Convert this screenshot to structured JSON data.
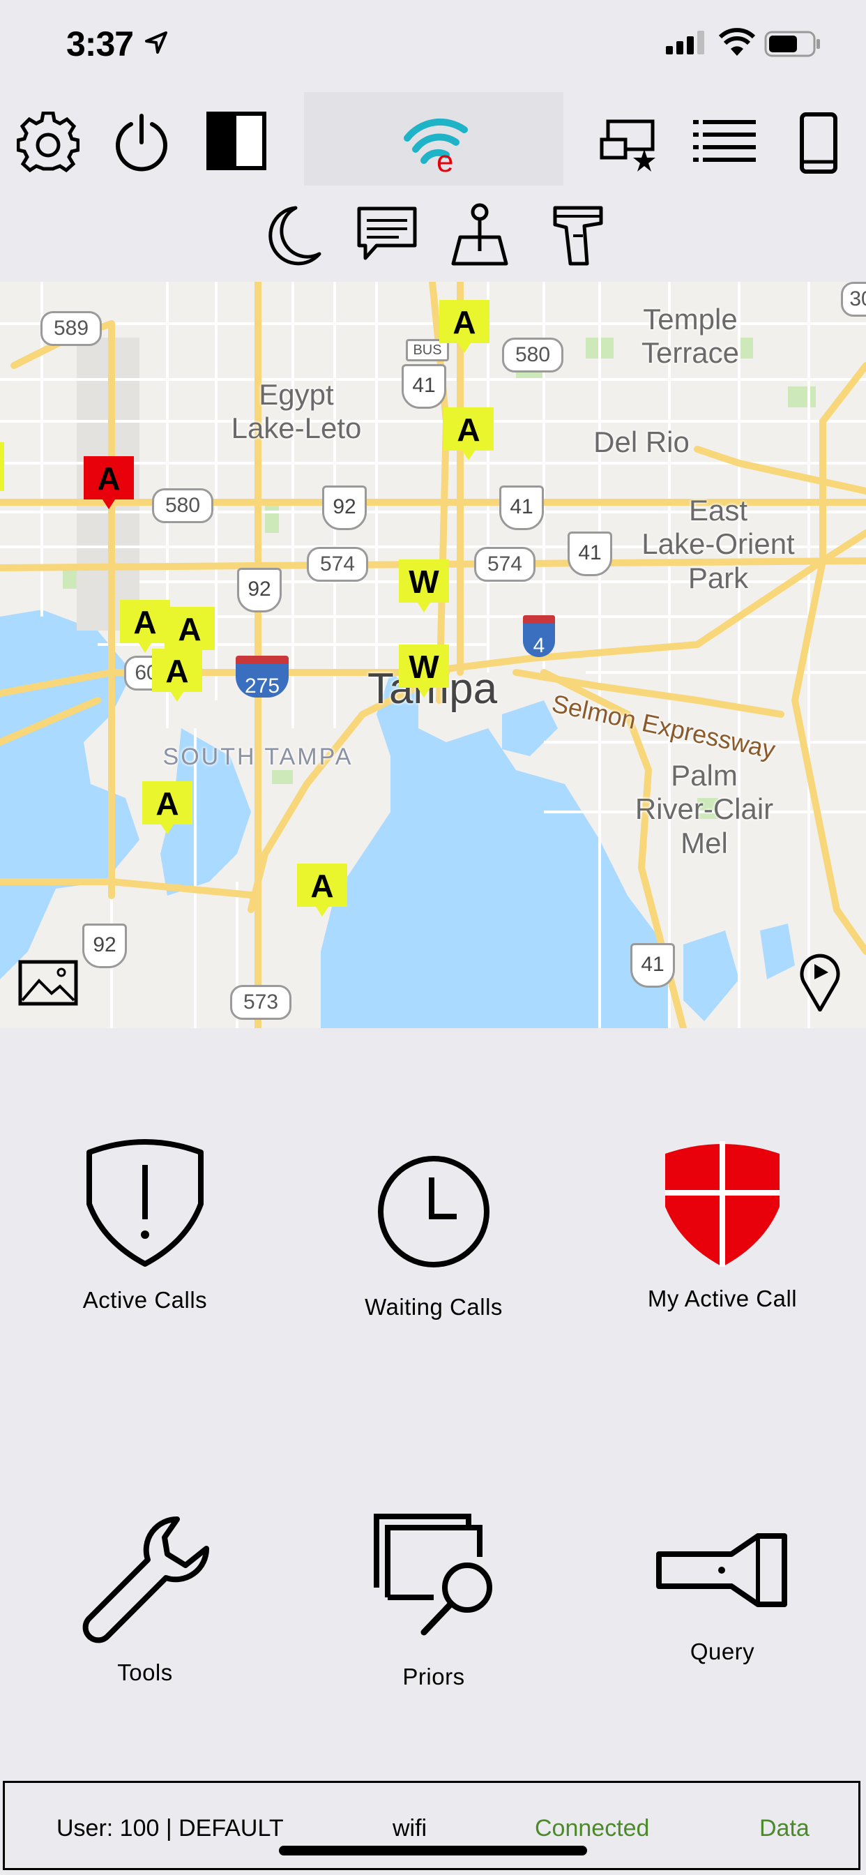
{
  "status_bar": {
    "time": "3:37"
  },
  "toolbar": {
    "row1": [
      "settings-gear-icon",
      "power-icon",
      "contrast-toggle-icon",
      "wifi-e-logo",
      "unit-star-icon",
      "list-icon",
      "phone-icon"
    ],
    "row2": [
      "night-mode-moon-icon",
      "messages-icon",
      "map-pin-icon",
      "scanner-gun-icon"
    ]
  },
  "map": {
    "place_labels": {
      "temple_terrace": "Temple\nTerrace",
      "egypt_lake_leto": "Egypt\nLake-Leto",
      "del_rio": "Del Rio",
      "east_lake_orient_park": "East\nLake-Orient\nPark",
      "tampa": "Tampa",
      "south_tampa": "SOUTH TAMPA",
      "selmon": "Selmon Expressway",
      "palm_river": "Palm\nRiver-Clair\nMel"
    },
    "road_shields": {
      "r589": "589",
      "r580a": "580",
      "r580b": "580",
      "r41a": "41",
      "r41b": "41",
      "r41c": "41",
      "r41d": "41",
      "r92a": "92",
      "r92b": "92",
      "r92c": "92",
      "r574a": "574",
      "r574b": "574",
      "r60": "60",
      "r573": "573",
      "r275": "275",
      "r4": "4",
      "bus": "BUS",
      "r30": "30"
    },
    "markers": {
      "m1": "A",
      "m2": "A",
      "m3": "A",
      "m4": "A",
      "m5": "A",
      "m6": "A",
      "m7": "A",
      "m8": "A",
      "w1": "W",
      "w2": "W"
    }
  },
  "tiles": {
    "active_calls": "Active Calls",
    "waiting_calls": "Waiting Calls",
    "my_active_call": "My Active Call",
    "tools": "Tools",
    "priors": "Priors",
    "query": "Query"
  },
  "footer": {
    "user": "User: 100 | DEFAULT",
    "network": "wifi",
    "connection": "Connected",
    "data": "Data"
  },
  "colors": {
    "accent_red": "#e8000a",
    "marker_yellow": "#e9f52d",
    "connected_green": "#4a8a2a",
    "logo_teal": "#1fb3c8"
  }
}
